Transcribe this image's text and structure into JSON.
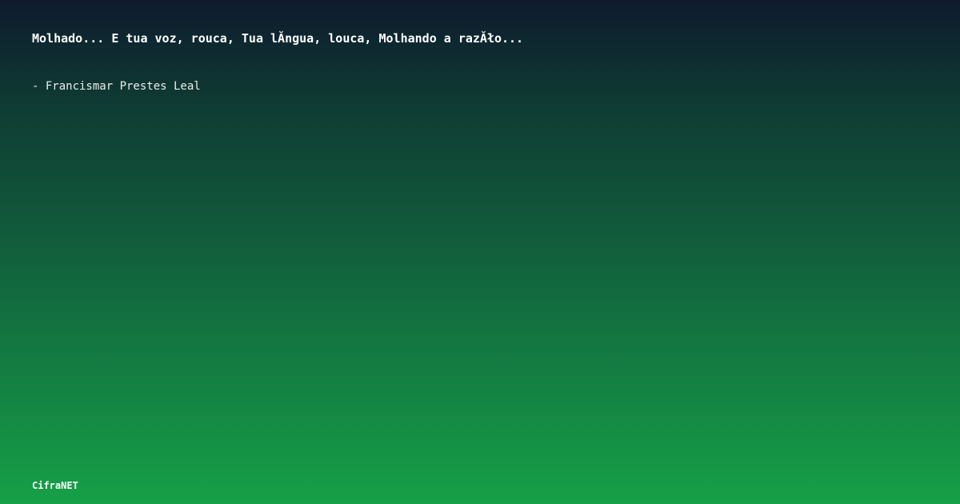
{
  "quote": {
    "text": "Molhado... E tua voz, rouca, Tua lĂ­ngua, louca, Molhando a razĂło..."
  },
  "author": {
    "text": "- Francismar Prestes Leal"
  },
  "brand": {
    "name": "CifraNET"
  },
  "colors": {
    "gradient_top": "#0e1a2d",
    "gradient_bottom": "#16a047",
    "text": "#ffffff"
  }
}
